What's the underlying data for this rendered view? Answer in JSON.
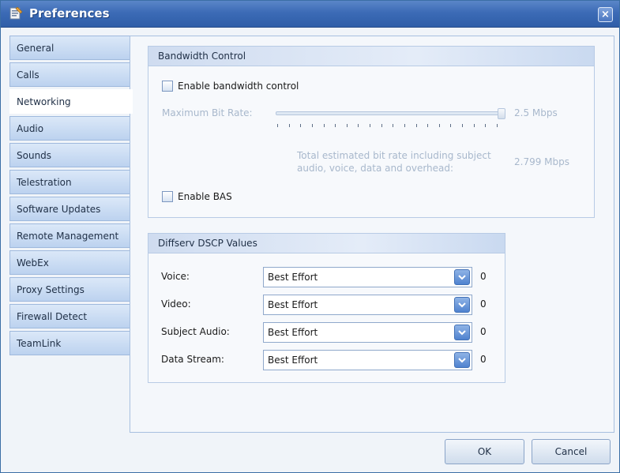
{
  "window": {
    "title": "Preferences",
    "close_label": "×"
  },
  "sidebar": {
    "items": [
      {
        "label": "General"
      },
      {
        "label": "Calls"
      },
      {
        "label": "Networking"
      },
      {
        "label": "Audio"
      },
      {
        "label": "Sounds"
      },
      {
        "label": "Telestration"
      },
      {
        "label": "Software Updates"
      },
      {
        "label": "Remote Management"
      },
      {
        "label": "WebEx"
      },
      {
        "label": "Proxy Settings"
      },
      {
        "label": "Firewall Detect"
      },
      {
        "label": "TeamLink"
      }
    ],
    "active_item": "Networking"
  },
  "bandwidth": {
    "title": "Bandwidth Control",
    "enable_label": "Enable bandwidth control",
    "enable_checked": false,
    "max_bit_rate_label": "Maximum Bit Rate:",
    "max_bit_rate_value": "2.5 Mbps",
    "slider_level": 1.0,
    "total_note": "Total estimated bit rate including subject audio, voice, data and overhead:",
    "total_value": "2.799 Mbps",
    "enable_bas_label": "Enable BAS",
    "enable_bas_checked": false
  },
  "diffserv": {
    "title": "Diffserv DSCP Values",
    "rows": [
      {
        "label": "Voice:",
        "value": "Best Effort",
        "code": "0"
      },
      {
        "label": "Video:",
        "value": "Best Effort",
        "code": "0"
      },
      {
        "label": "Subject Audio:",
        "value": "Best Effort",
        "code": "0"
      },
      {
        "label": "Data Stream:",
        "value": "Best Effort",
        "code": "0"
      }
    ]
  },
  "buttons": {
    "ok": "OK",
    "cancel": "Cancel"
  },
  "colors": {
    "titlebar": "#3c6bb6",
    "accent": "#4f82cf",
    "panel": "#f4f7fb"
  }
}
